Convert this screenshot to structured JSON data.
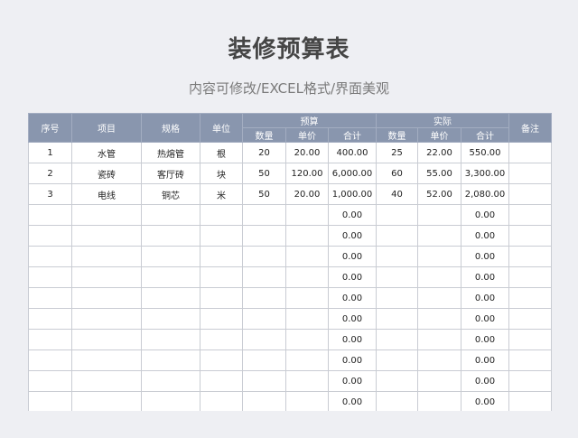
{
  "title": "装修预算表",
  "subtitle": "内容可修改/EXCEL格式/界面美观",
  "colors": {
    "header_bg": "#8996ae",
    "header_text": "#ffffff",
    "page_bg": "#eeeff3"
  },
  "table": {
    "headers": {
      "seq": "序号",
      "item": "项目",
      "spec": "规格",
      "unit": "单位",
      "budget": "预算",
      "actual": "实际",
      "remark": "备注",
      "qty": "数量",
      "price": "单价",
      "total": "合计"
    },
    "rows": [
      [
        "1",
        "水管",
        "热熔管",
        "根",
        "20",
        "20.00",
        "400.00",
        "25",
        "22.00",
        "550.00",
        ""
      ],
      [
        "2",
        "瓷砖",
        "客厅砖",
        "块",
        "50",
        "120.00",
        "6,000.00",
        "60",
        "55.00",
        "3,300.00",
        ""
      ],
      [
        "3",
        "电线",
        "铜芯",
        "米",
        "50",
        "20.00",
        "1,000.00",
        "40",
        "52.00",
        "2,080.00",
        ""
      ],
      [
        "",
        "",
        "",
        "",
        "",
        "",
        "0.00",
        "",
        "",
        "0.00",
        ""
      ],
      [
        "",
        "",
        "",
        "",
        "",
        "",
        "0.00",
        "",
        "",
        "0.00",
        ""
      ],
      [
        "",
        "",
        "",
        "",
        "",
        "",
        "0.00",
        "",
        "",
        "0.00",
        ""
      ],
      [
        "",
        "",
        "",
        "",
        "",
        "",
        "0.00",
        "",
        "",
        "0.00",
        ""
      ],
      [
        "",
        "",
        "",
        "",
        "",
        "",
        "0.00",
        "",
        "",
        "0.00",
        ""
      ],
      [
        "",
        "",
        "",
        "",
        "",
        "",
        "0.00",
        "",
        "",
        "0.00",
        ""
      ],
      [
        "",
        "",
        "",
        "",
        "",
        "",
        "0.00",
        "",
        "",
        "0.00",
        ""
      ],
      [
        "",
        "",
        "",
        "",
        "",
        "",
        "0.00",
        "",
        "",
        "0.00",
        ""
      ],
      [
        "",
        "",
        "",
        "",
        "",
        "",
        "0.00",
        "",
        "",
        "0.00",
        ""
      ],
      [
        "",
        "",
        "",
        "",
        "",
        "",
        "0.00",
        "",
        "",
        "0.00",
        ""
      ]
    ]
  }
}
